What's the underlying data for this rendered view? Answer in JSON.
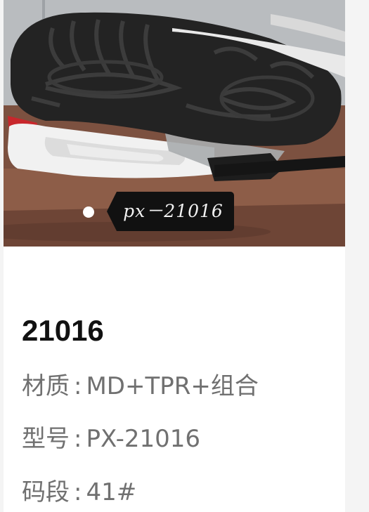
{
  "product": {
    "image_tag": "px－21016",
    "title": "21016",
    "attributes": [
      {
        "label": "材质",
        "separator": ":",
        "value": "MD+TPR+组合"
      },
      {
        "label": "型号",
        "separator": ":",
        "value": "PX-21016"
      },
      {
        "label": "码段",
        "separator": ":",
        "value": "41#"
      }
    ]
  },
  "colors": {
    "card_background": "#ffffff",
    "page_background": "#f4f4f4",
    "title_text": "#111111",
    "attribute_text": "#707070",
    "tag_background": "#111111"
  }
}
